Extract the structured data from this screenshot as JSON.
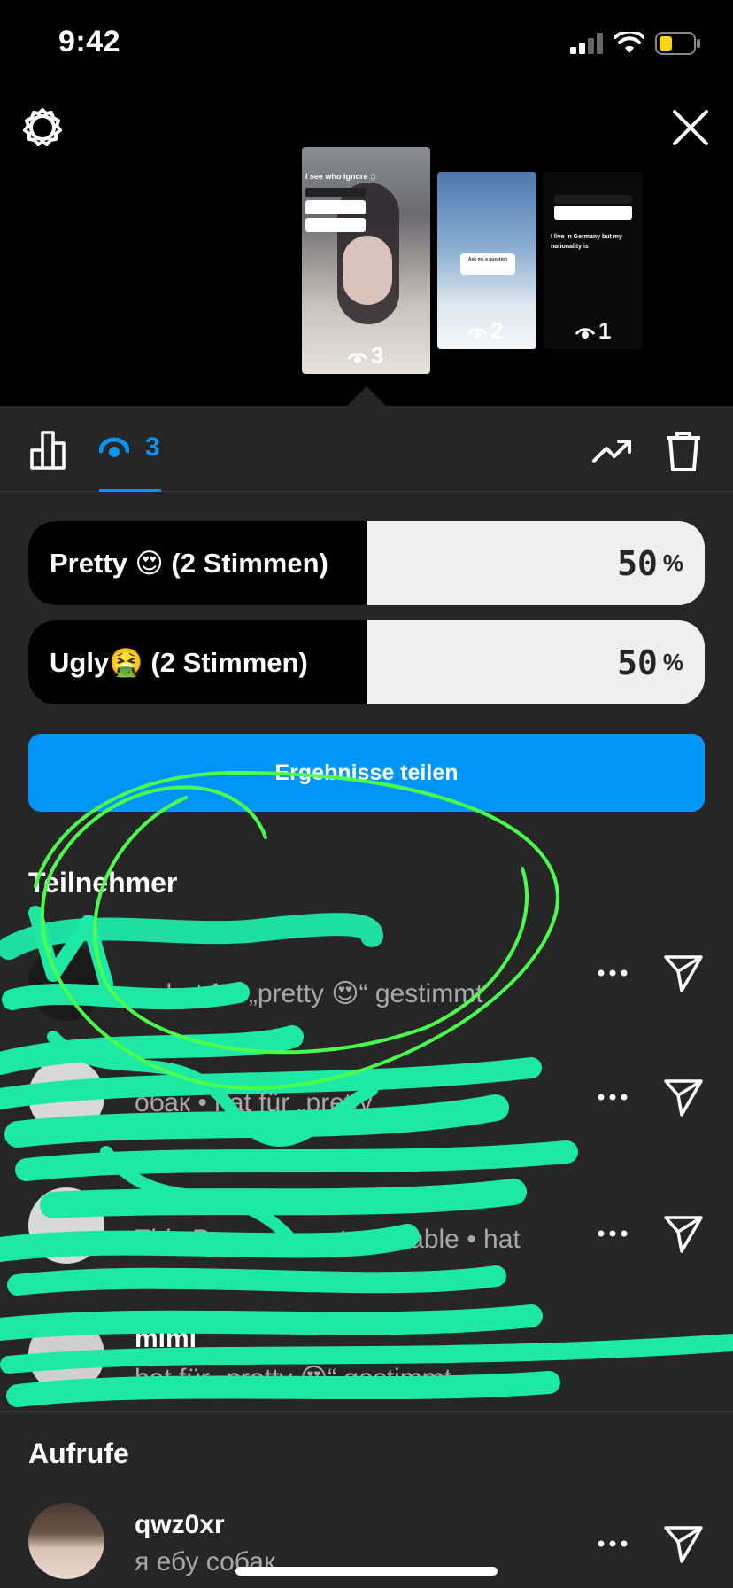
{
  "status_bar": {
    "time": "9:42"
  },
  "story_thumbs": [
    {
      "caption": "I see who ignore :)",
      "views": "3"
    },
    {
      "caption": "Ask me a question",
      "views": "2"
    },
    {
      "caption": "I live in Germany but my nationality is",
      "views": "1"
    }
  ],
  "tabs": {
    "viewers_count": "3"
  },
  "poll": {
    "options": [
      {
        "label": "Pretty 😍 (2 Stimmen)",
        "percent": "50",
        "share": 0.5
      },
      {
        "label": "Ugly🤮 (2 Stimmen)",
        "percent": "50",
        "share": 0.5
      }
    ],
    "percent_sign": "%"
  },
  "share_button": "Ergebnisse teilen",
  "participants": {
    "title": "Teilnehmer",
    "rows": [
      {
        "name": "",
        "sub": ". • hat für „pretty 😍“ gestimmt"
      },
      {
        "name": "",
        "sub": "обак • hat für „pretty"
      },
      {
        "name": "",
        "sub": "This Person is not available • hat"
      },
      {
        "name": "mimi",
        "sub": "hat für „pretty 😍“ gestimmt"
      }
    ]
  },
  "views_section": {
    "title": "Aufrufe",
    "rows": [
      {
        "name": "qwz0xr",
        "sub": "я ебу собак"
      }
    ]
  },
  "colors": {
    "accent": "#0095f6",
    "sheet": "#262626",
    "scribble_green": "#1de9a5"
  }
}
